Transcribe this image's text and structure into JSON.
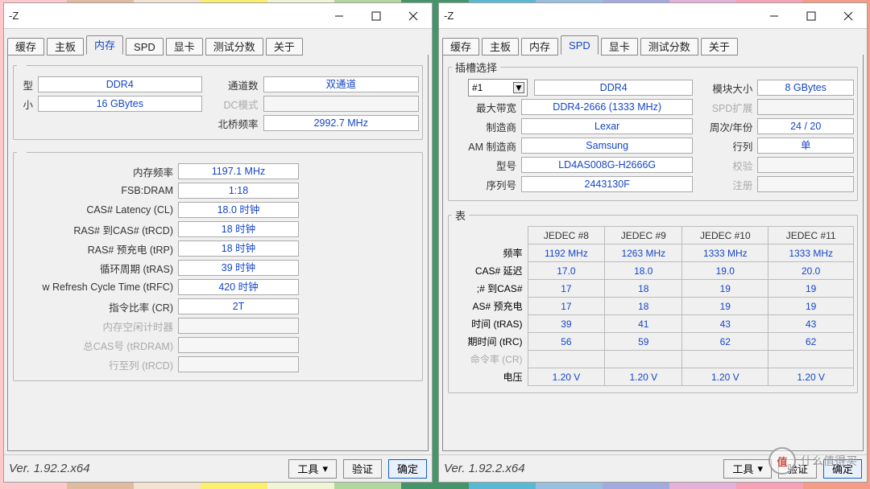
{
  "bg_colors": [
    "#ffc9cb",
    "#e0bba0",
    "#f2e2d2",
    "#faf06e",
    "#eff5d6",
    "#b2d6a0",
    "#45946a",
    "#5bb8d2",
    "#99bfe0",
    "#a3aade",
    "#e7b0d6",
    "#f8a0b6",
    "#f59c86"
  ],
  "window_title": "-Z",
  "tabs": [
    "缓存",
    "主板",
    "内存",
    "SPD",
    "显卡",
    "测试分数",
    "关于"
  ],
  "memory": {
    "group1_legend": "",
    "fields_left": [
      {
        "label": "型",
        "value": "DDR4"
      },
      {
        "label": "小",
        "value": "16 GBytes"
      }
    ],
    "fields_right": [
      {
        "label": "通道数",
        "value": "双通道"
      },
      {
        "label": "DC模式",
        "value": "",
        "dim": true
      },
      {
        "label": "北桥频率",
        "value": "2992.7 MHz"
      }
    ],
    "timings": [
      {
        "label": "内存频率",
        "value": "1197.1 MHz"
      },
      {
        "label": "FSB:DRAM",
        "value": "1:18"
      },
      {
        "label": "CAS# Latency  (CL)",
        "value": "18.0 时钟"
      },
      {
        "label": "RAS# 到CAS#  (tRCD)",
        "value": "18 时钟"
      },
      {
        "label": "RAS# 预充电  (tRP)",
        "value": "18 时钟"
      },
      {
        "label": "循环周期  (tRAS)",
        "value": "39 时钟"
      },
      {
        "label": "w Refresh Cycle Time  (tRFC)",
        "value": "420 时钟"
      },
      {
        "label": "指令比率  (CR)",
        "value": "2T"
      },
      {
        "label": "内存空闲计时器",
        "value": "",
        "dim": true
      },
      {
        "label": "总CAS号 (tRDRAM)",
        "value": "",
        "dim": true
      },
      {
        "label": "行至列 (tRCD)",
        "value": "",
        "dim": true
      }
    ]
  },
  "spd": {
    "slot_legend": "插槽选择",
    "slot_dropdown": "#1",
    "left": [
      {
        "label": "",
        "value": "DDR4"
      },
      {
        "label": "最大带宽",
        "value": "DDR4-2666 (1333 MHz)"
      },
      {
        "label": "制造商",
        "value": "Lexar"
      },
      {
        "label": "AM 制造商",
        "value": "Samsung"
      },
      {
        "label": "型号",
        "value": "LD4AS008G-H2666G"
      },
      {
        "label": "序列号",
        "value": "2443130F"
      }
    ],
    "right": [
      {
        "label": "模块大小",
        "value": "8 GBytes"
      },
      {
        "label": "SPD扩展",
        "value": "",
        "dim": true
      },
      {
        "label": "周次/年份",
        "value": "24 / 20"
      },
      {
        "label": "行列",
        "value": "单"
      },
      {
        "label": "校验",
        "value": "",
        "dim": true
      },
      {
        "label": "注册",
        "value": "",
        "dim": true
      }
    ],
    "timing_legend": "表",
    "table_headers": [
      "JEDEC #8",
      "JEDEC #9",
      "JEDEC #10",
      "JEDEC #11"
    ],
    "table_rows": [
      {
        "label": "频率",
        "v": [
          "1192 MHz",
          "1263 MHz",
          "1333 MHz",
          "1333 MHz"
        ]
      },
      {
        "label": "CAS# 延迟",
        "v": [
          "17.0",
          "18.0",
          "19.0",
          "20.0"
        ]
      },
      {
        "label": ";# 到CAS#",
        "v": [
          "17",
          "18",
          "19",
          "19"
        ]
      },
      {
        "label": "AS# 预充电",
        "v": [
          "17",
          "18",
          "19",
          "19"
        ]
      },
      {
        "label": "时间 (tRAS)",
        "v": [
          "39",
          "41",
          "43",
          "43"
        ]
      },
      {
        "label": "期时间 (tRC)",
        "v": [
          "56",
          "59",
          "62",
          "62"
        ]
      },
      {
        "label": "命令率 (CR)",
        "v": [
          "",
          "",
          "",
          ""
        ],
        "dim": true
      },
      {
        "label": "电压",
        "v": [
          "1.20 V",
          "1.20 V",
          "1.20 V",
          "1.20 V"
        ]
      }
    ]
  },
  "footer": {
    "version": "Ver. 1.92.2.x64",
    "tools": "工具",
    "verify": "验证",
    "ok": "确定"
  },
  "watermark": {
    "circle": "值",
    "text": "什么值得买"
  }
}
